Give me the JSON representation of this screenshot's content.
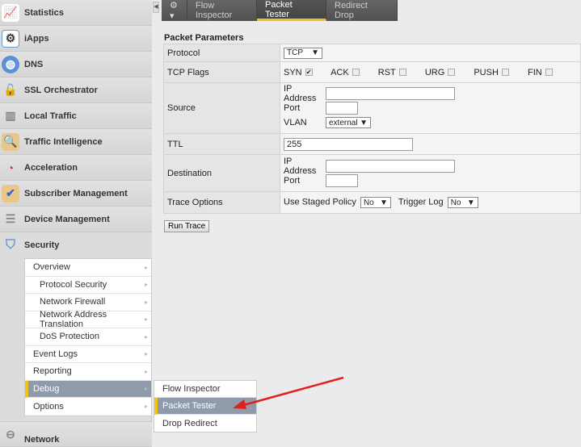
{
  "sidebar": {
    "items": [
      {
        "label": "Statistics",
        "icon": "statistics-icon"
      },
      {
        "label": "iApps",
        "icon": "iapps-icon"
      },
      {
        "label": "DNS",
        "icon": "globe-icon"
      },
      {
        "label": "SSL Orchestrator",
        "icon": "lock-icon"
      },
      {
        "label": "Local Traffic",
        "icon": "servers-icon"
      },
      {
        "label": "Traffic Intelligence",
        "icon": "clipboard-search-icon"
      },
      {
        "label": "Acceleration",
        "icon": "gauge-icon"
      },
      {
        "label": "Subscriber Management",
        "icon": "clipboard-check-icon"
      },
      {
        "label": "Device Management",
        "icon": "device-icon"
      },
      {
        "label": "Security",
        "icon": "shield-icon"
      }
    ],
    "network": "Network",
    "submenu": [
      "Overview",
      "Protocol Security",
      "Network Firewall",
      "Network Address Translation",
      "DoS Protection",
      "Event Logs",
      "Reporting",
      "Debug",
      "Options"
    ],
    "flyout": [
      "Flow Inspector",
      "Packet Tester",
      "Drop Redirect"
    ]
  },
  "tabs": [
    "Flow Inspector",
    "Packet Tester",
    "Redirect Drop"
  ],
  "form": {
    "title": "Packet Parameters",
    "protocol_label": "Protocol",
    "protocol": "TCP",
    "flags_label": "TCP Flags",
    "flags": [
      "SYN",
      "ACK",
      "RST",
      "URG",
      "PUSH",
      "FIN"
    ],
    "source_label": "Source",
    "ip_label": "IP Address",
    "port_label": "Port",
    "vlan_label": "VLAN",
    "vlan": "external",
    "ttl_label": "TTL",
    "ttl": "255",
    "dest_label": "Destination",
    "trace_label": "Trace Options",
    "staged_label": "Use Staged Policy",
    "staged": "No",
    "log_label": "Trigger Log",
    "log": "No",
    "run": "Run Trace"
  },
  "colors": {
    "accent": "#f0c419",
    "active": "#8f9aaa",
    "arrow": "#e02020"
  }
}
